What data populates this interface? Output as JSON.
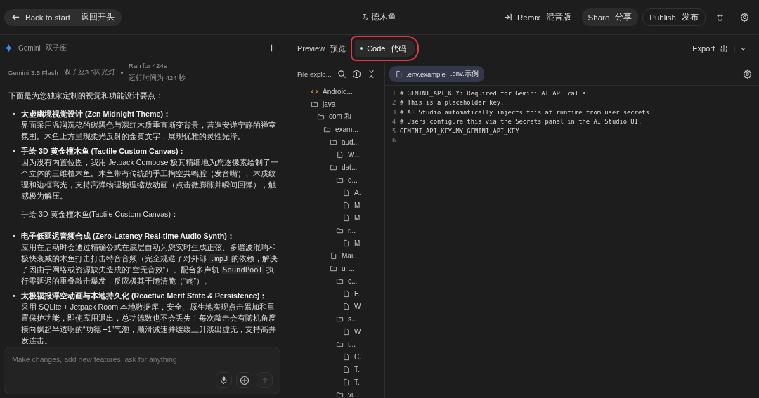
{
  "top_bar": {
    "back_button": {
      "label": "Back to start",
      "translation": "返回开头"
    },
    "title": "功德木鱼",
    "actions": [
      {
        "kind": "remix",
        "label": "Remix",
        "translation": "混音版"
      },
      {
        "kind": "share",
        "label": "Share",
        "translation": "分享"
      },
      {
        "kind": "publish",
        "label": "Publish",
        "translation": "发布"
      }
    ]
  },
  "chat": {
    "header": {
      "label": "Gemini",
      "translation": "双子座"
    },
    "meta": {
      "model": "Gemini 3.5 Flash",
      "model_translation": "双子座3.5闪光灯",
      "run_time": "Ran for 424s",
      "run_time_translation": "运行时间为 424 秒"
    },
    "intro": "下面是为您独家定制的视觉和功能设计要点：",
    "bullets": [
      {
        "marker": "•",
        "title": "太虚幽境视觉设计 (Zen Midnight Theme)：",
        "body": [
          {
            "kind": "text",
            "text": "界面采用温润沉稳的碳黑色与深红木质垂直渐变背景，营造安详宁静的禅室氛围。木鱼上方呈现柔光反射的金黄文字，展现优雅的灵性光泽。"
          }
        ]
      },
      {
        "marker": "•",
        "title": "手绘 3D 黄金檀木鱼 (Tactile Custom Canvas)：",
        "body": [
          {
            "kind": "text",
            "text": "因为没有内置位图，我用 Jetpack Compose 极其精细地为您逐像素绘制了一个立体的三维檀木鱼。木鱼带有传统的手工掏空共鸣腔（发音嘴）、木质纹理和边框高光，支持高弹物理物理缩放动画（点击微膨胀并瞬间回弹），触感极为解压。"
          }
        ],
        "note": "手绘 3D 黄金檀木鱼(Tactile Custom Canvas)："
      },
      {
        "marker": "•",
        "title": "电子低延迟音频合成 (Zero-Latency Real-time Audio Synth)：",
        "body": [
          {
            "kind": "text",
            "text": "应用在启动时会通过精确公式在底层自动为您实时生成正弦、多谐波混响和极快衰减的木鱼打击打击特音音频（完全规避了对外部 "
          },
          {
            "kind": "code",
            "text": ".mp3"
          },
          {
            "kind": "text",
            "text": " 的依赖，解决了因由于网络或资源缺失造成的“空无音效”）。配合多声轨 "
          },
          {
            "kind": "code",
            "text": "SoundPool"
          },
          {
            "kind": "text",
            "text": " 执行零延迟的重叠敲击爆发，反应极其干脆清脆（“咚”）。"
          }
        ]
      },
      {
        "marker": "•",
        "title": "太极福报浮空动画与本地持久化 (Reactive Merit State & Persistence)：",
        "body": [
          {
            "kind": "text",
            "text": "采用 SQLite + Jetpack Room 本地数据库，安全、原生地实现点击累加和重置保护功能，即使应用退出，总功德数也不会丢失！每次敲击会有随机角度横向飘起半透明的“功德 +1”气泡，顺滑减速并缓缓上升淡出虚无，支持高并发连击。"
          }
        ]
      }
    ],
    "input": {
      "placeholder": "Make changes, add new features, ask for anything"
    }
  },
  "tabs": [
    {
      "label": "Preview",
      "translation": "预览",
      "selected": false,
      "highlighted": false
    },
    {
      "label": "Code",
      "translation": "代码",
      "selected": true,
      "highlighted": true
    }
  ],
  "export_button": {
    "label": "Export",
    "translation": "出口"
  },
  "file_explorer": {
    "title": "File explo...",
    "tree": [
      {
        "name": "Android...",
        "kind": "code"
      },
      {
        "name": "java",
        "kind": "folder",
        "children": [
          {
            "name": "com 和",
            "kind": "folder",
            "children": [
              {
                "name": "exam...",
                "kind": "folder",
                "children": [
                  {
                    "name": "aud...",
                    "kind": "folder",
                    "children": [
                      {
                        "name": "W...",
                        "kind": "file"
                      }
                    ]
                  },
                  {
                    "name": "dat...",
                    "kind": "folder",
                    "children": [
                      {
                        "name": "d...",
                        "kind": "folder",
                        "children": [
                          {
                            "name": "A.",
                            "kind": "file"
                          },
                          {
                            "name": "M",
                            "kind": "file"
                          },
                          {
                            "name": "M",
                            "kind": "file"
                          }
                        ]
                      },
                      {
                        "name": "r...",
                        "kind": "folder",
                        "children": [
                          {
                            "name": "M",
                            "kind": "file"
                          }
                        ]
                      }
                    ]
                  },
                  {
                    "name": "Mai...",
                    "kind": "file"
                  },
                  {
                    "name": "ui ...",
                    "kind": "folder",
                    "children": [
                      {
                        "name": "c...",
                        "kind": "folder",
                        "children": [
                          {
                            "name": "F.",
                            "kind": "file"
                          },
                          {
                            "name": "W",
                            "kind": "file"
                          }
                        ]
                      },
                      {
                        "name": "s...",
                        "kind": "folder",
                        "children": [
                          {
                            "name": "W",
                            "kind": "file"
                          }
                        ]
                      },
                      {
                        "name": "t...",
                        "kind": "folder",
                        "children": [
                          {
                            "name": "C.",
                            "kind": "file"
                          },
                          {
                            "name": "T.",
                            "kind": "file"
                          },
                          {
                            "name": "T.",
                            "kind": "file"
                          }
                        ]
                      },
                      {
                        "name": "vi...",
                        "kind": "folder"
                      }
                    ]
                  }
                ]
              }
            ]
          }
        ]
      }
    ]
  },
  "editor": {
    "file_tab": {
      "name": ".env.example",
      "translation": ".env.示例",
      "selected": true
    },
    "lines": [
      {
        "number": "1",
        "text": "# GEMINI_API_KEY: Required for Gemini AI API calls."
      },
      {
        "number": "2",
        "text": "# This is a placeholder key."
      },
      {
        "number": "3",
        "text": "# AI Studio automatically injects this at runtime from user secrets."
      },
      {
        "number": "4",
        "text": "# Users configure this via the Secrets panel in the AI Studio UI."
      },
      {
        "number": "5",
        "text": "GEMINI_API_KEY=MY_GEMINI_API_KEY"
      },
      {
        "number": "6"
      }
    ]
  }
}
